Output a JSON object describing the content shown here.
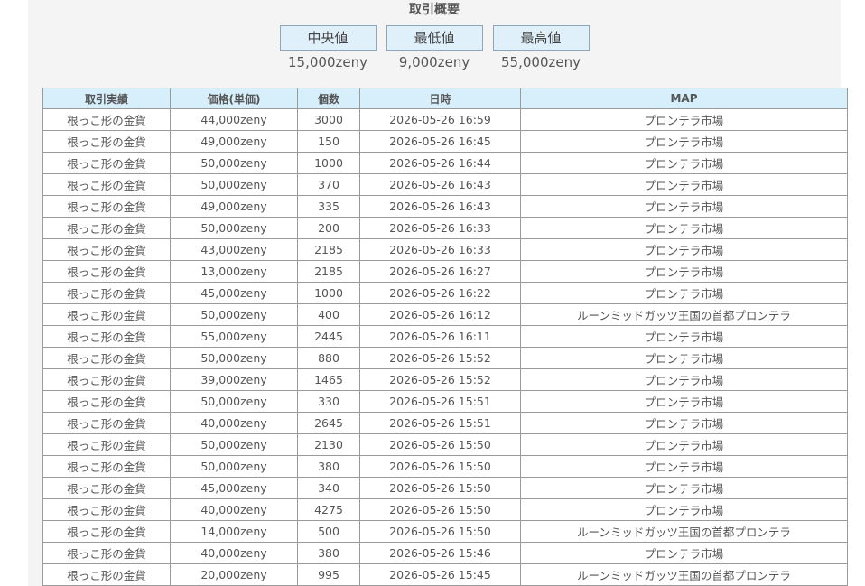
{
  "summary": {
    "title": "取引概要",
    "stats": [
      {
        "label": "中央値",
        "value": "15,000zeny"
      },
      {
        "label": "最低値",
        "value": "9,000zeny"
      },
      {
        "label": "最高値",
        "value": "55,000zeny"
      }
    ]
  },
  "table": {
    "headers": [
      "取引実績",
      "価格(単価)",
      "個数",
      "日時",
      "MAP"
    ],
    "rows": [
      [
        "根っこ形の金貨",
        "44,000zeny",
        "3000",
        "2026-05-26 16:59",
        "プロンテラ市場"
      ],
      [
        "根っこ形の金貨",
        "49,000zeny",
        "150",
        "2026-05-26 16:45",
        "プロンテラ市場"
      ],
      [
        "根っこ形の金貨",
        "50,000zeny",
        "1000",
        "2026-05-26 16:44",
        "プロンテラ市場"
      ],
      [
        "根っこ形の金貨",
        "50,000zeny",
        "370",
        "2026-05-26 16:43",
        "プロンテラ市場"
      ],
      [
        "根っこ形の金貨",
        "49,000zeny",
        "335",
        "2026-05-26 16:43",
        "プロンテラ市場"
      ],
      [
        "根っこ形の金貨",
        "50,000zeny",
        "200",
        "2026-05-26 16:33",
        "プロンテラ市場"
      ],
      [
        "根っこ形の金貨",
        "43,000zeny",
        "2185",
        "2026-05-26 16:33",
        "プロンテラ市場"
      ],
      [
        "根っこ形の金貨",
        "13,000zeny",
        "2185",
        "2026-05-26 16:27",
        "プロンテラ市場"
      ],
      [
        "根っこ形の金貨",
        "45,000zeny",
        "1000",
        "2026-05-26 16:22",
        "プロンテラ市場"
      ],
      [
        "根っこ形の金貨",
        "50,000zeny",
        "400",
        "2026-05-26 16:12",
        "ルーンミッドガッツ王国の首都プロンテラ"
      ],
      [
        "根っこ形の金貨",
        "55,000zeny",
        "2445",
        "2026-05-26 16:11",
        "プロンテラ市場"
      ],
      [
        "根っこ形の金貨",
        "50,000zeny",
        "880",
        "2026-05-26 15:52",
        "プロンテラ市場"
      ],
      [
        "根っこ形の金貨",
        "39,000zeny",
        "1465",
        "2026-05-26 15:52",
        "プロンテラ市場"
      ],
      [
        "根っこ形の金貨",
        "50,000zeny",
        "330",
        "2026-05-26 15:51",
        "プロンテラ市場"
      ],
      [
        "根っこ形の金貨",
        "40,000zeny",
        "2645",
        "2026-05-26 15:51",
        "プロンテラ市場"
      ],
      [
        "根っこ形の金貨",
        "50,000zeny",
        "2130",
        "2026-05-26 15:50",
        "プロンテラ市場"
      ],
      [
        "根っこ形の金貨",
        "50,000zeny",
        "380",
        "2026-05-26 15:50",
        "プロンテラ市場"
      ],
      [
        "根っこ形の金貨",
        "45,000zeny",
        "340",
        "2026-05-26 15:50",
        "プロンテラ市場"
      ],
      [
        "根っこ形の金貨",
        "40,000zeny",
        "4275",
        "2026-05-26 15:50",
        "プロンテラ市場"
      ],
      [
        "根っこ形の金貨",
        "14,000zeny",
        "500",
        "2026-05-26 15:50",
        "ルーンミッドガッツ王国の首都プロンテラ"
      ],
      [
        "根っこ形の金貨",
        "40,000zeny",
        "380",
        "2026-05-26 15:46",
        "プロンテラ市場"
      ],
      [
        "根っこ形の金貨",
        "20,000zeny",
        "995",
        "2026-05-26 15:45",
        "ルーンミッドガッツ王国の首都プロンテラ"
      ]
    ]
  }
}
